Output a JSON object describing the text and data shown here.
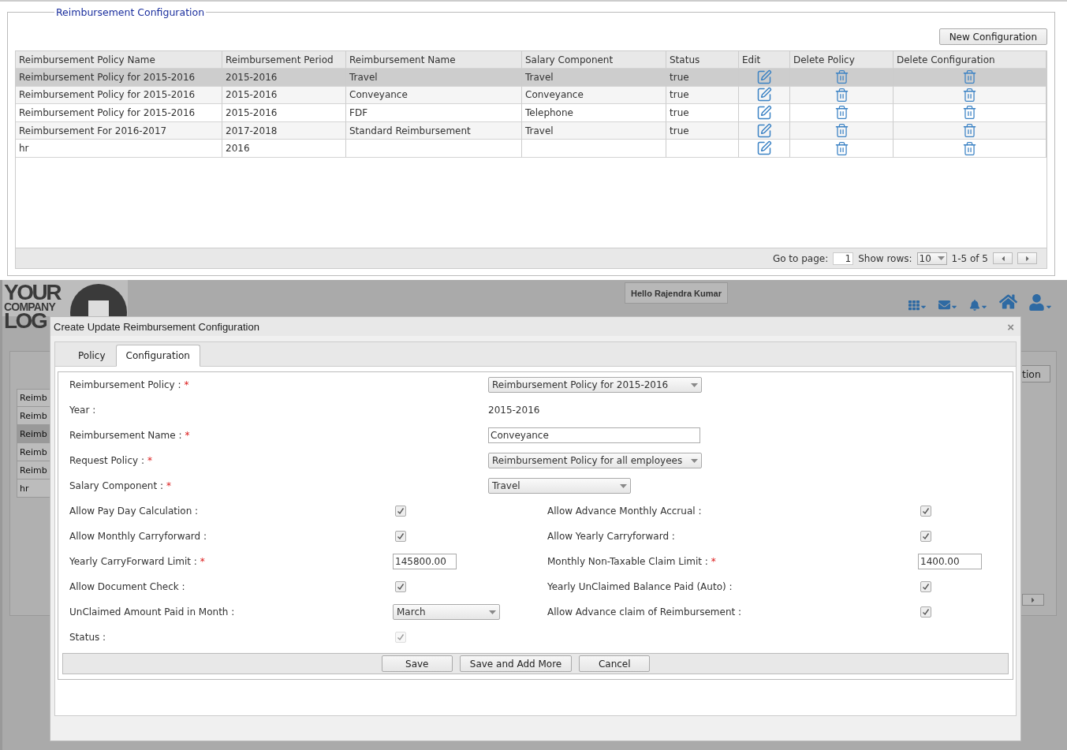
{
  "top": {
    "title": "Reimbursement Configuration",
    "new_button": "New Configuration",
    "table": {
      "columns": [
        "Reimbursement Policy Name",
        "Reimbursement Period",
        "Reimbursement Name",
        "Salary Component",
        "Status",
        "Edit",
        "Delete Policy",
        "Delete Configuration"
      ],
      "rows": [
        {
          "selected": true,
          "cells": [
            "Reimbursement Policy for 2015-2016",
            "2015-2016",
            "Travel",
            "Travel",
            "true"
          ]
        },
        {
          "selected": false,
          "cells": [
            "Reimbursement Policy for 2015-2016",
            "2015-2016",
            "Conveyance",
            "Conveyance",
            "true"
          ]
        },
        {
          "selected": false,
          "cells": [
            "Reimbursement Policy for 2015-2016",
            "2015-2016",
            "FDF",
            "Telephone",
            "true"
          ]
        },
        {
          "selected": false,
          "cells": [
            "Reimbursement For 2016-2017",
            "2017-2018",
            "Standard Reimbursement",
            "Travel",
            "true"
          ]
        },
        {
          "selected": false,
          "cells": [
            "hr",
            "2016",
            null,
            null,
            null
          ]
        }
      ]
    },
    "pager": {
      "go_to_label": "Go to page:",
      "page": "1",
      "show_rows_label": "Show rows:",
      "rows_value": "10",
      "range": "1-5 of 5"
    }
  },
  "header": {
    "logo": [
      "YOUR",
      "COMPANY",
      "LOG"
    ],
    "greeting": "Hello Rajendra Kumar"
  },
  "background": {
    "button_fragment": "tion",
    "rows": [
      {
        "text": "Reimb",
        "selected": false
      },
      {
        "text": "Reimb",
        "selected": false
      },
      {
        "text": "Reimb",
        "selected": true
      },
      {
        "text": "Reimb",
        "selected": false
      },
      {
        "text": "Reimb",
        "selected": false
      },
      {
        "text": "hr",
        "selected": false
      }
    ]
  },
  "modal": {
    "title": "Create Update Reimbursement Configuration",
    "close": "×",
    "tabs": [
      {
        "label": "Policy",
        "selected": false
      },
      {
        "label": "Configuration",
        "selected": true
      }
    ],
    "fields": [
      {
        "label": "Reimbursement Policy :",
        "required": true,
        "kind": "select",
        "value": "Reimbursement Policy for 2015-2016"
      },
      {
        "label": "Year :",
        "required": false,
        "kind": "text",
        "value": "2015-2016"
      },
      {
        "label": "Reimbursement Name :",
        "required": true,
        "kind": "input",
        "value": "Conveyance"
      },
      {
        "label": "Request Policy :",
        "required": true,
        "kind": "select",
        "value": "Reimbursement Policy for all employees"
      },
      {
        "label": "Salary Component :",
        "required": true,
        "kind": "select_short",
        "value": "Travel"
      }
    ],
    "pairs": [
      [
        {
          "label": "Allow Pay Day Calculation :",
          "required": false,
          "kind": "checkbox",
          "checked": true,
          "disabled": false
        },
        {
          "label": "Allow Advance Monthly Accrual :",
          "required": false,
          "kind": "checkbox",
          "checked": true,
          "disabled": false
        }
      ],
      [
        {
          "label": "Allow Monthly Carryforward :",
          "required": false,
          "kind": "checkbox",
          "checked": true,
          "disabled": false
        },
        {
          "label": "Allow Yearly Carryforward :",
          "required": false,
          "kind": "checkbox",
          "checked": true,
          "disabled": false
        }
      ],
      [
        {
          "label": "Yearly CarryForward Limit :",
          "required": true,
          "kind": "input",
          "value": "145800.00"
        },
        {
          "label": "Monthly Non-Taxable Claim Limit :",
          "required": true,
          "kind": "input",
          "value": "1400.00"
        }
      ],
      [
        {
          "label": "Allow Document Check :",
          "required": false,
          "kind": "checkbox",
          "checked": true,
          "disabled": false
        },
        {
          "label": "Yearly UnClaimed Balance Paid (Auto) :",
          "required": false,
          "kind": "checkbox",
          "checked": true,
          "disabled": false
        }
      ],
      [
        {
          "label": "UnClaimed Amount Paid in Month :",
          "required": false,
          "kind": "select",
          "value": "March"
        },
        {
          "label": "Allow Advance claim of Reimbursement :",
          "required": false,
          "kind": "checkbox",
          "checked": true,
          "disabled": false
        }
      ],
      [
        {
          "label": "Status :",
          "required": false,
          "kind": "checkbox",
          "checked": true,
          "disabled": true
        }
      ]
    ],
    "required_mark": "*",
    "buttons": [
      "Save",
      "Save and Add More",
      "Cancel"
    ]
  }
}
